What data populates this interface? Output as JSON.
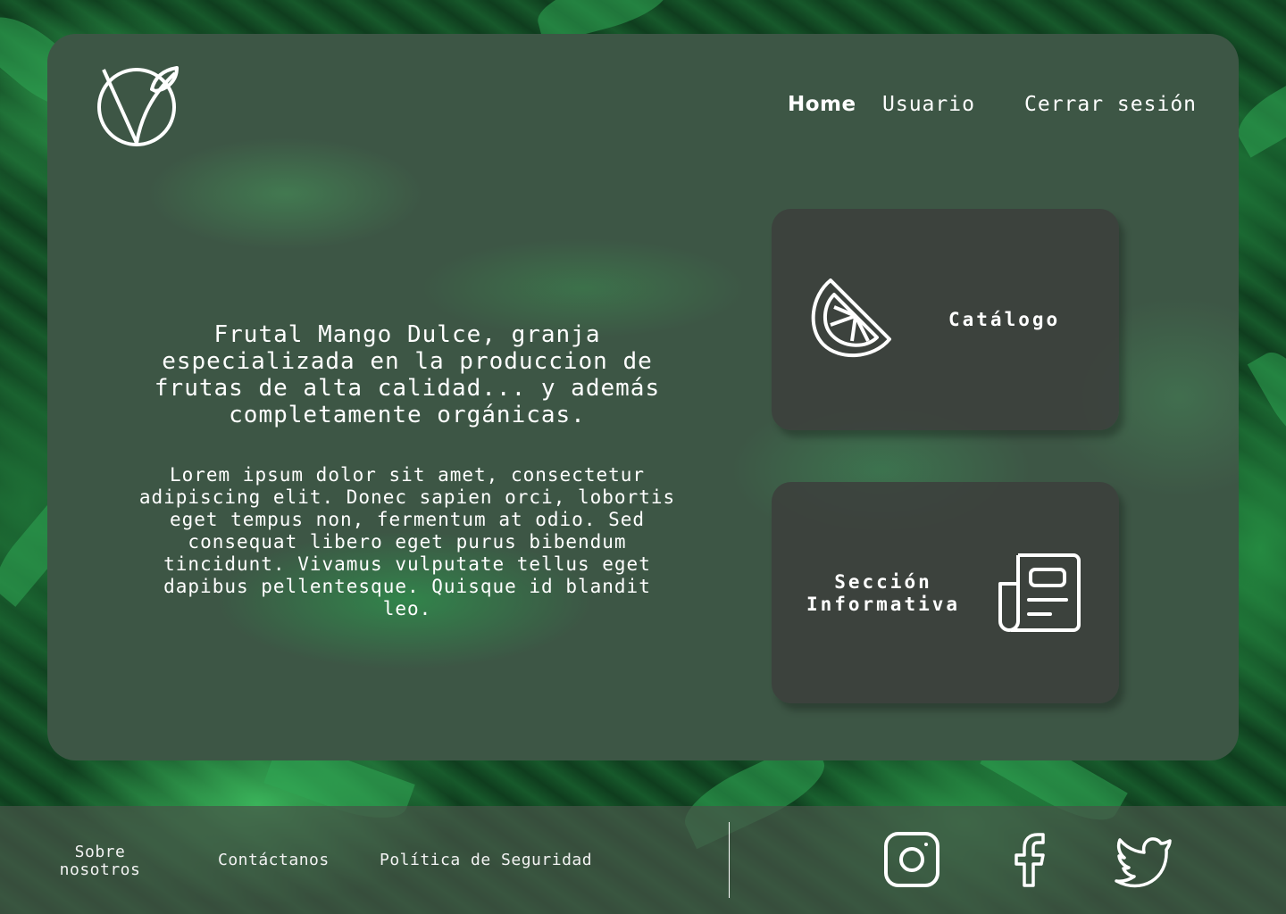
{
  "header": {
    "logo_icon": "organic-vegan-leaf-logo-icon",
    "nav": {
      "home": "Home",
      "user": "Usuario",
      "logout": "Cerrar sesión"
    }
  },
  "main": {
    "headline": "Frutal Mango Dulce, granja especializada en la produccion de frutas de alta calidad... y además completamente orgánicas.",
    "body": "Lorem ipsum dolor sit amet, consectetur adipiscing elit. Donec sapien orci, lobortis eget tempus non, fermentum at odio. Sed consequat libero eget purus bibendum tincidunt. Vivamus vulputate tellus eget dapibus pellentesque. Quisque id blandit leo."
  },
  "cards": {
    "catalog": {
      "label": "Catálogo",
      "icon": "citrus-slice-icon"
    },
    "info": {
      "label": "Sección Informativa",
      "icon": "newspaper-icon"
    }
  },
  "footer": {
    "about": "Sobre nosotros",
    "contact": "Contáctanos",
    "policy": "Política de Seguridad",
    "social": [
      "instagram-icon",
      "facebook-icon",
      "twitter-icon"
    ]
  },
  "colors": {
    "panel": "#3d5645",
    "card": "#3c3e3c",
    "text": "#ffffff",
    "background_leaf": "#2fa553"
  }
}
